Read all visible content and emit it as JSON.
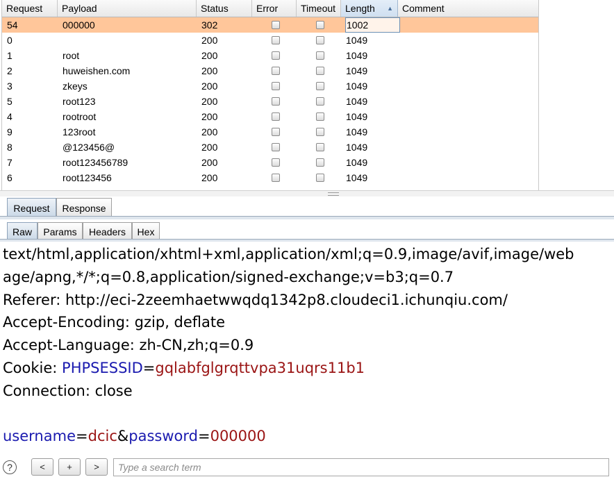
{
  "table": {
    "columns": [
      "Request",
      "Payload",
      "Status",
      "Error",
      "Timeout",
      "Length",
      "Comment"
    ],
    "sorted_column": "Length",
    "rows": [
      {
        "request": "54",
        "payload": "000000",
        "status": "302",
        "length": "1002",
        "selected": true
      },
      {
        "request": "0",
        "payload": "",
        "status": "200",
        "length": "1049"
      },
      {
        "request": "1",
        "payload": "root",
        "status": "200",
        "length": "1049"
      },
      {
        "request": "2",
        "payload": "huweishen.com",
        "status": "200",
        "length": "1049"
      },
      {
        "request": "3",
        "payload": "zkeys",
        "status": "200",
        "length": "1049"
      },
      {
        "request": "5",
        "payload": "root123",
        "status": "200",
        "length": "1049"
      },
      {
        "request": "4",
        "payload": "rootroot",
        "status": "200",
        "length": "1049"
      },
      {
        "request": "9",
        "payload": "123root",
        "status": "200",
        "length": "1049"
      },
      {
        "request": "8",
        "payload": "@123456@",
        "status": "200",
        "length": "1049"
      },
      {
        "request": "7",
        "payload": "root123456789",
        "status": "200",
        "length": "1049"
      },
      {
        "request": "6",
        "payload": "root123456",
        "status": "200",
        "length": "1049"
      }
    ]
  },
  "tabs": {
    "top": [
      "Request",
      "Response"
    ],
    "top_active": "Request",
    "sub": [
      "Raw",
      "Params",
      "Headers",
      "Hex"
    ],
    "sub_active": "Raw"
  },
  "raw": {
    "line1": "text/html,application/xhtml+xml,application/xml;q=0.9,image/avif,image/webp,image/apng,*/*;q=0.8,application/signed-exchange;v=b3;q=0.7",
    "line1_a": "text/html,application/xhtml+xml,application/xml;q=0.9,image/avif,image/web",
    "line1_b": "age/apng,*/*;q=0.8,application/signed-exchange;v=b3;q=0.7",
    "referer": "Referer: http://eci-2zeemhaetwwqdq1342p8.cloudeci1.ichunqiu.com/",
    "encoding": "Accept-Encoding: gzip, deflate",
    "language": "Accept-Language: zh-CN,zh;q=0.9",
    "cookie_label": "Cookie: ",
    "cookie_name": "PHPSESSID",
    "cookie_eq": "=",
    "cookie_value": "gqlabfglgrqttvpa31uqrs11b1",
    "connection": "Connection: close",
    "body_user_key": "username",
    "body_eq1": "=",
    "body_user_val": "dcic",
    "body_amp": "&",
    "body_pass_key": "password",
    "body_eq2": "=",
    "body_pass_val": "000000"
  },
  "search": {
    "help": "?",
    "prev": "<",
    "add": "+",
    "next": ">",
    "placeholder": "Type a search term"
  }
}
